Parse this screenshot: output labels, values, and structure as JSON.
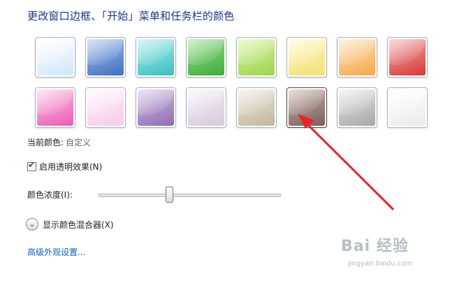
{
  "title": "更改窗口边框、「开始」菜单和任务栏的颜色",
  "swatches": [
    {
      "name": "sky",
      "top": "#ffffff",
      "bottom": "#cfe6fb"
    },
    {
      "name": "twilight",
      "top": "#a9c3ef",
      "bottom": "#3f6dbd"
    },
    {
      "name": "sea",
      "top": "#a8ecec",
      "bottom": "#3dbfc0"
    },
    {
      "name": "leaf",
      "top": "#9cdf93",
      "bottom": "#3eaa3a"
    },
    {
      "name": "lime",
      "top": "#d9f2a2",
      "bottom": "#9fd44b"
    },
    {
      "name": "lemon",
      "top": "#fdf7c4",
      "bottom": "#f1e275"
    },
    {
      "name": "pumpkin",
      "top": "#fde1b8",
      "bottom": "#f5a84a"
    },
    {
      "name": "ruby",
      "top": "#f3a9a9",
      "bottom": "#d53a3a"
    },
    {
      "name": "fuchsia",
      "top": "#fbc4e6",
      "bottom": "#ea5cb3"
    },
    {
      "name": "blush",
      "top": "#fff3fb",
      "bottom": "#f7c9ea"
    },
    {
      "name": "violet",
      "top": "#d3c4e6",
      "bottom": "#8e6bb4"
    },
    {
      "name": "lavender",
      "top": "#f3eef6",
      "bottom": "#d7c9de"
    },
    {
      "name": "taupe",
      "top": "#ece6da",
      "bottom": "#c2b69d"
    },
    {
      "name": "chocolate",
      "top": "#c7b3ae",
      "bottom": "#7d5e58"
    },
    {
      "name": "slate",
      "top": "#e6e6e6",
      "bottom": "#a7a7a7"
    },
    {
      "name": "frost",
      "top": "#ffffff",
      "bottom": "#eaeaea"
    }
  ],
  "current_color": {
    "label": "当前颜色:",
    "value": "自定义"
  },
  "transparency": {
    "label": "启用透明效果(N)",
    "checked": true
  },
  "intensity": {
    "label": "颜色浓度(I):",
    "value_fraction": 0.39
  },
  "mixer": {
    "label": "显示颜色混合器(X)"
  },
  "advanced": {
    "label": "高级外观设置..."
  },
  "watermark": {
    "text": "Bai 经验",
    "sub": "jingyan.baidu.com"
  }
}
